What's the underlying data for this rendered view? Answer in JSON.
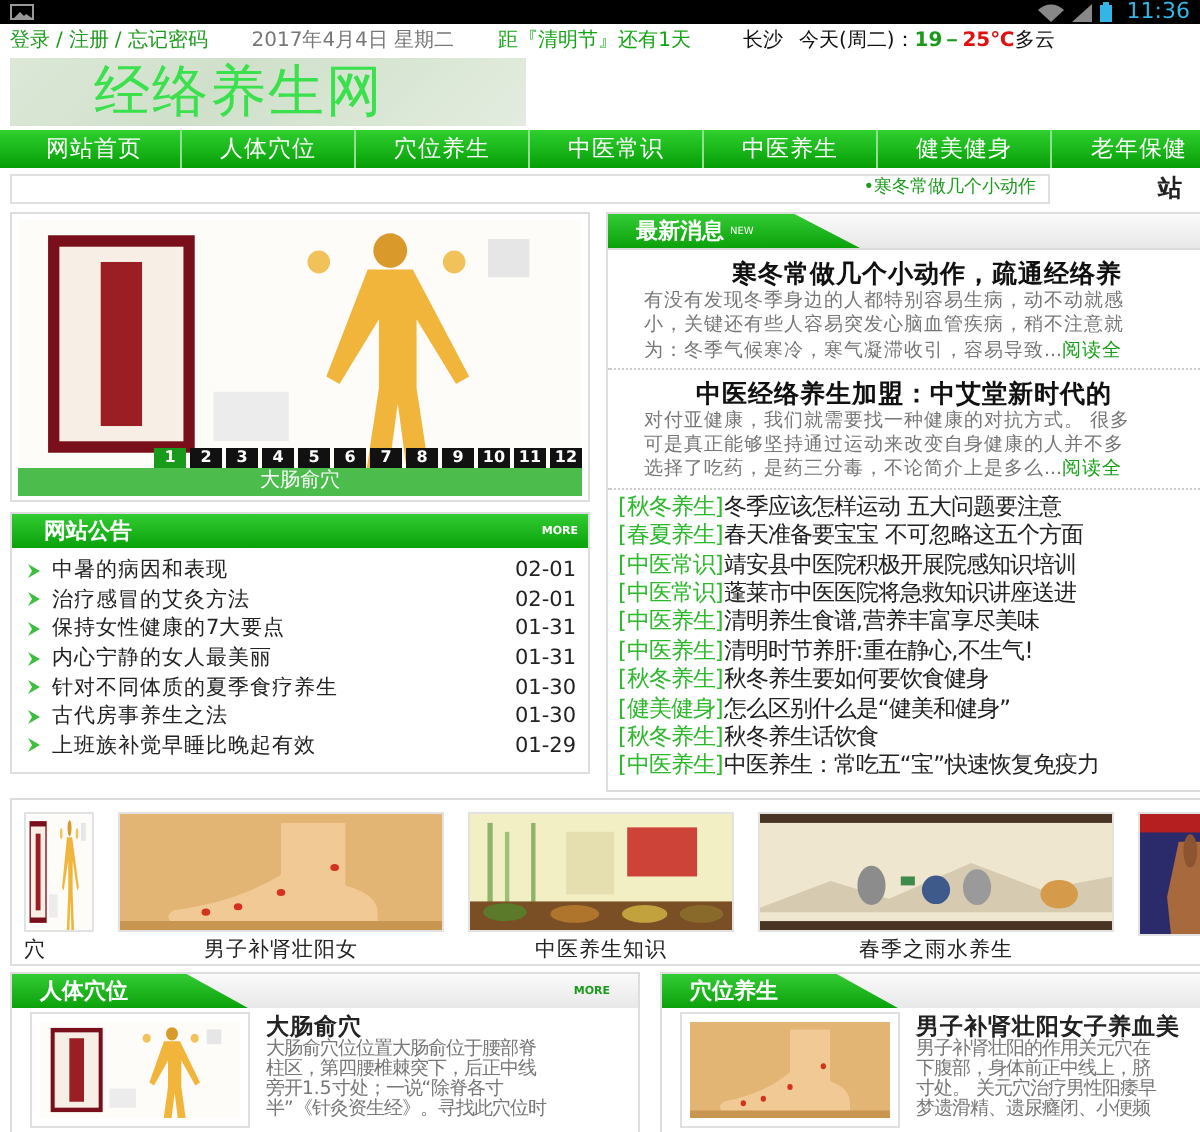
{
  "status_bar": {
    "time": "11:36"
  },
  "top_bar": {
    "account_links": [
      "登录",
      "注册",
      "忘记密码"
    ],
    "separator": "/",
    "date": "2017年4月4日 星期二",
    "countdown": "距『清明节』还有1天",
    "weather": {
      "city": "长沙",
      "day": "今天(周二)：",
      "low": "19－",
      "high": "25℃",
      "condition": "多云"
    }
  },
  "logo": "经络养生网",
  "nav": [
    "网站首页",
    "人体穴位",
    "穴位养生",
    "中医常识",
    "中医养生",
    "健美健身",
    "老年保健"
  ],
  "ticker": "•寒冬常做几个小动作",
  "side_heading": "站",
  "slider": {
    "kind": "picture",
    "pages": [
      {
        "label": "1",
        "selected": true
      },
      {
        "label": "2",
        "selected": false
      },
      {
        "label": "3",
        "selected": false
      },
      {
        "label": "4",
        "selected": false
      },
      {
        "label": "5",
        "selected": false
      },
      {
        "label": "6",
        "selected": false
      },
      {
        "label": "7",
        "selected": false
      },
      {
        "label": "8",
        "selected": false
      },
      {
        "label": "9",
        "selected": false
      },
      {
        "label": "10",
        "selected": false
      },
      {
        "label": "11",
        "selected": false
      },
      {
        "label": "12",
        "selected": false
      }
    ],
    "caption": "大肠俞穴"
  },
  "notices": {
    "title": "网站公告",
    "more": "MORE",
    "items": [
      {
        "title": "中暑的病因和表现",
        "date": "02-01"
      },
      {
        "title": "治疗感冒的艾灸方法",
        "date": "02-01"
      },
      {
        "title": "保持女性健康的7大要点",
        "date": "01-31"
      },
      {
        "title": "内心宁静的女人最美丽",
        "date": "01-31"
      },
      {
        "title": "针对不同体质的夏季食疗养生",
        "date": "01-30"
      },
      {
        "title": "古代房事养生之法",
        "date": "01-30"
      },
      {
        "title": "上班族补觉早睡比晚起有效",
        "date": "01-29"
      }
    ]
  },
  "news": {
    "title": "最新消息",
    "badge": "NEW",
    "articles": [
      {
        "title": "寒冬常做几个小动作，疏通经络养",
        "lines": [
          "有没有发现冬季身边的人都特别容易生病，动不动就感",
          "小，关键还有些人容易突发心脑血管疾病，稍不注意就",
          "为：冬季气候寒冷，寒气凝滞收引，容易导致..."
        ],
        "more": "阅读全"
      },
      {
        "title": "中医经络养生加盟：中艾堂新时代的",
        "lines": [
          "对付亚健康，我们就需要找一种健康的对抗方式。 很多",
          "可是真正能够坚持通过运动来改变自身健康的人并不多",
          "选择了吃药，是药三分毒，不论简介上是多么..."
        ],
        "more": "阅读全"
      }
    ],
    "items": [
      {
        "tag": "[秋冬养生]",
        "text": "冬季应该怎样运动 五大问题要注意"
      },
      {
        "tag": "[春夏养生]",
        "text": "春天准备要宝宝 不可忽略这五个方面"
      },
      {
        "tag": "[中医常识]",
        "text": "靖安县中医院积极开展院感知识培训"
      },
      {
        "tag": "[中医常识]",
        "text": "蓬莱市中医医院将急救知识讲座送进"
      },
      {
        "tag": "[中医养生]",
        "text": "清明养生食谱,营养丰富享尽美味"
      },
      {
        "tag": "[中医养生]",
        "text": "清明时节养肝:重在静心,不生气!"
      },
      {
        "tag": "[秋冬养生]",
        "text": "秋冬养生要如何要饮食健身"
      },
      {
        "tag": "[健美健身]",
        "text": "怎么区别什么是“健美和健身”"
      },
      {
        "tag": "[秋冬养生]",
        "text": "秋冬养生话饮食"
      },
      {
        "tag": "[中医养生]",
        "text": "中医养生：常吃五“宝”快速恢复免疫力"
      }
    ]
  },
  "gallery": [
    {
      "kind": "picture",
      "caption": "穴"
    },
    {
      "kind": "picture",
      "caption": "男子补肾壮阳女"
    },
    {
      "kind": "picture",
      "caption": "中医养生知识"
    },
    {
      "kind": "picture",
      "caption": "春季之雨水养生"
    },
    {
      "kind": "picture"
    }
  ],
  "panels": [
    {
      "title": "人体穴位",
      "more": "MORE",
      "entry": {
        "title": "大肠俞穴",
        "lines": [
          "大肠俞穴位位置大肠俞位于腰部脊",
          "柱区，第四腰椎棘突下，后正中线",
          "旁开1.5寸处；一说“除脊各寸",
          "半”《针灸资生经》。寻找此穴位时"
        ]
      }
    },
    {
      "title": "穴位养生",
      "entry": {
        "title": "男子补肾壮阳女子养血美",
        "lines": [
          "男子补肾壮阳的作用关元穴在",
          "下腹部，身体前正中线上，脐",
          "寸处。 关元穴治疗男性阳痿早",
          "梦遗滑精、遗尿癃闭、小便频"
        ]
      }
    }
  ]
}
